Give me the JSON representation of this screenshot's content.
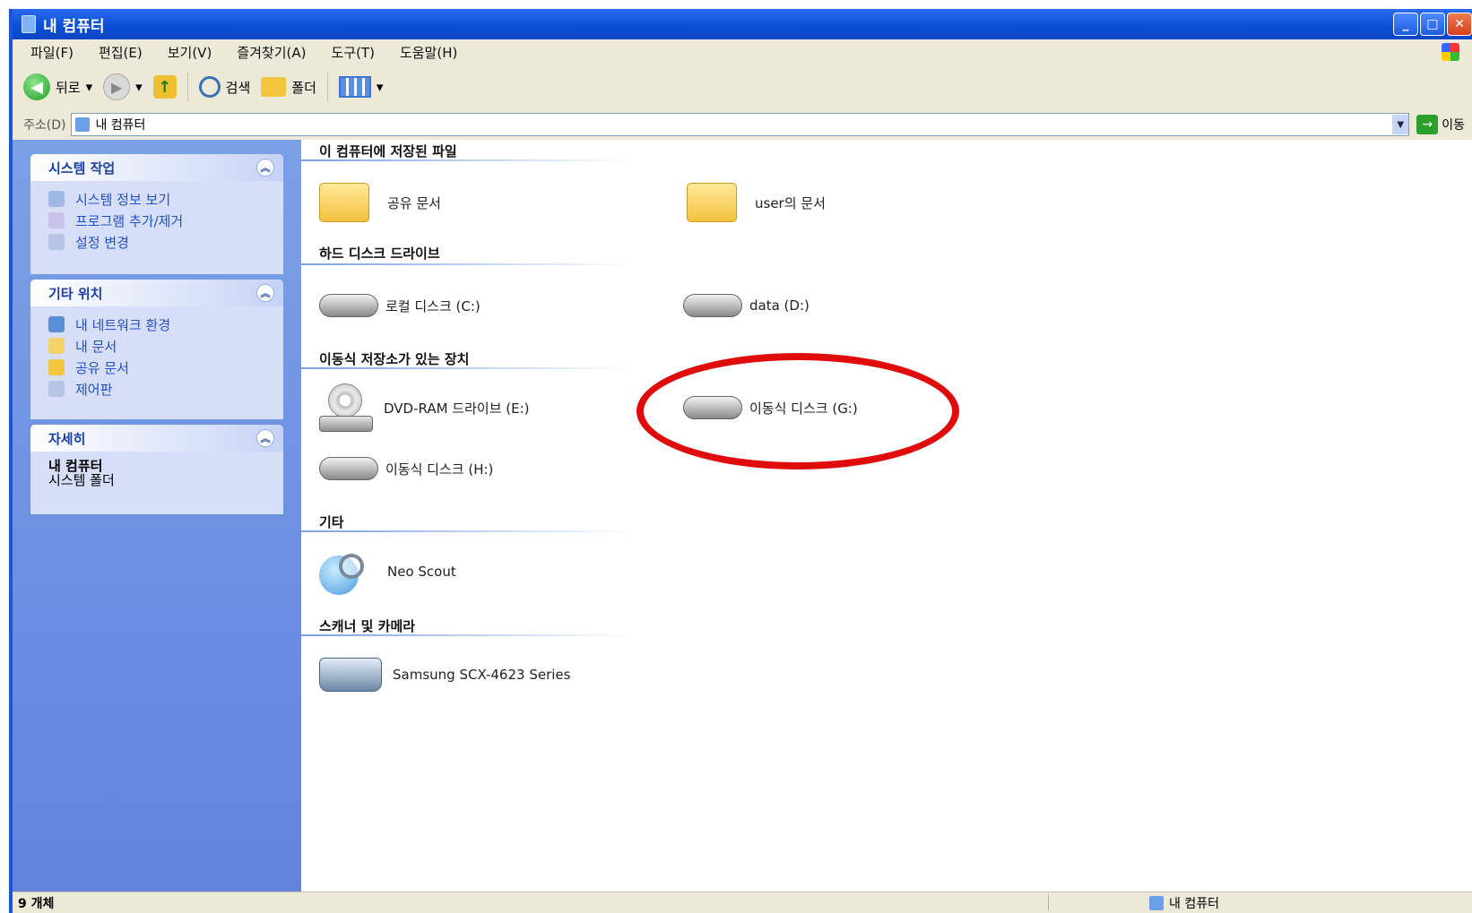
{
  "window": {
    "title": "내 컴퓨터",
    "min": "_",
    "max": "□",
    "close": "✕"
  },
  "menu": [
    "파일(F)",
    "편집(E)",
    "보기(V)",
    "즐겨찾기(A)",
    "도구(T)",
    "도움말(H)"
  ],
  "toolbar": {
    "back": "뒤로",
    "search": "검색",
    "folders": "폴더"
  },
  "address": {
    "label": "주소(D)",
    "value": "내 컴퓨터",
    "go": "이동"
  },
  "sidebar": {
    "system_tasks": {
      "title": "시스템 작업",
      "items": [
        "시스템 정보 보기",
        "프로그램 추가/제거",
        "설정 변경"
      ]
    },
    "other_places": {
      "title": "기타 위치",
      "items": [
        "내 네트워크 환경",
        "내 문서",
        "공유 문서",
        "제어판"
      ]
    },
    "details": {
      "title": "자세히",
      "name": "내 컴퓨터",
      "sub": "시스템 폴더"
    }
  },
  "groups": {
    "stored_files": {
      "title": "이 컴퓨터에 저장된 파일",
      "items": [
        "공유 문서",
        "user의 문서"
      ]
    },
    "hard_disks": {
      "title": "하드 디스크 드라이브",
      "items": [
        "로컬 디스크 (C:)",
        "data (D:)"
      ]
    },
    "removable": {
      "title": "이동식 저장소가 있는 장치",
      "items": [
        "DVD-RAM 드라이브 (E:)",
        "이동식 디스크 (G:)",
        "이동식 디스크 (H:)"
      ]
    },
    "other": {
      "title": "기타",
      "items": [
        "Neo Scout"
      ]
    },
    "scanners": {
      "title": "스캐너 및 카메라",
      "items": [
        "Samsung SCX-4623 Series"
      ]
    }
  },
  "status": {
    "count": "9 개체",
    "location": "내 컴퓨터"
  },
  "colors": {
    "title_bar": "#0a4fd6",
    "sidebar": "#6f95e2",
    "highlight_circle": "#e00c0c"
  }
}
